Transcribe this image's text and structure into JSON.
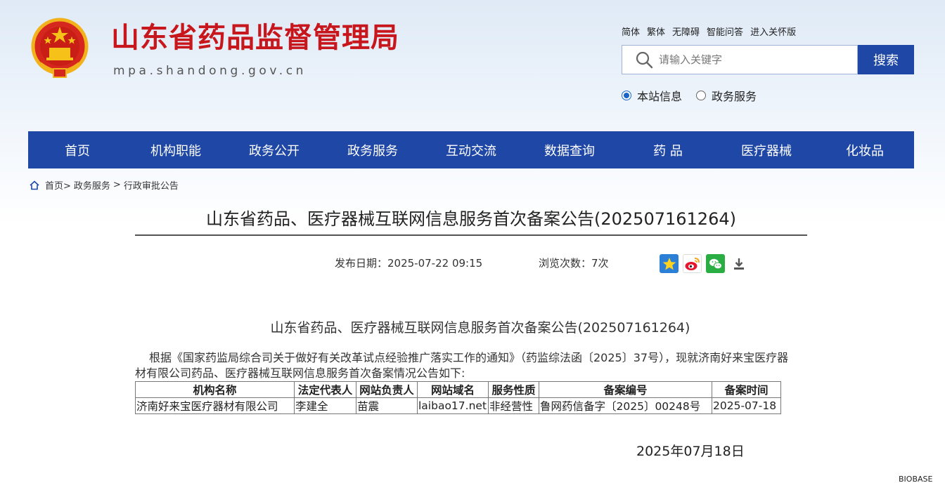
{
  "header": {
    "site_title": "山东省药品监督管理局",
    "site_url": "mpa.shandong.gov.cn",
    "top_links": [
      "简体",
      "繁体",
      "无障碍",
      "智能问答",
      "进入关怀版"
    ],
    "search": {
      "placeholder": "请输入关键字",
      "button_label": "搜索"
    },
    "radios": [
      {
        "label": "本站信息",
        "checked": true
      },
      {
        "label": "政务服务",
        "checked": false
      }
    ]
  },
  "nav": {
    "items": [
      "首页",
      "机构职能",
      "政务公开",
      "政务服务",
      "互动交流",
      "数据查询",
      "药 品",
      "医疗器械",
      "化妆品"
    ]
  },
  "breadcrumb": {
    "items": [
      "首页>",
      "政务服务",
      ">",
      "行政审批公告"
    ]
  },
  "article": {
    "title": "山东省药品、医疗器械互联网信息服务首次备案公告(202507161264)",
    "publish_date": "发布日期：2025-07-22 09:15",
    "views": "浏览次数：7次",
    "share_icons": [
      "favorite-star-icon",
      "weibo-icon",
      "wechat-icon",
      "download-icon"
    ],
    "doc_heading": "山东省药品、医疗器械互联网信息服务首次备案公告(202507161264)",
    "paragraph": "根据《国家药监局综合司关于做好有关改革试点经验推广落实工作的通知》（药监综法函〔2025〕37号），现就济南好来宝医疗器材有限公司药品、医疗器械互联网信息服务首次备案情况公告如下:",
    "table": {
      "headers": [
        "机构名称",
        "法定代表人",
        "网站负责人",
        "网站域名",
        "服务性质",
        "备案编号",
        "备案时间"
      ],
      "rows": [
        [
          "济南好来宝医疗器材有限公司",
          "李建全",
          "苗震",
          "laibao17.net",
          "非经营性",
          "鲁网药信备字〔2025〕00248号",
          "2025-07-18"
        ]
      ]
    },
    "sign_date": "2025年07月18日"
  },
  "watermark": "BIOBASE",
  "colors": {
    "brand_red": "#c8161d",
    "nav_blue": "#1f47a6"
  }
}
